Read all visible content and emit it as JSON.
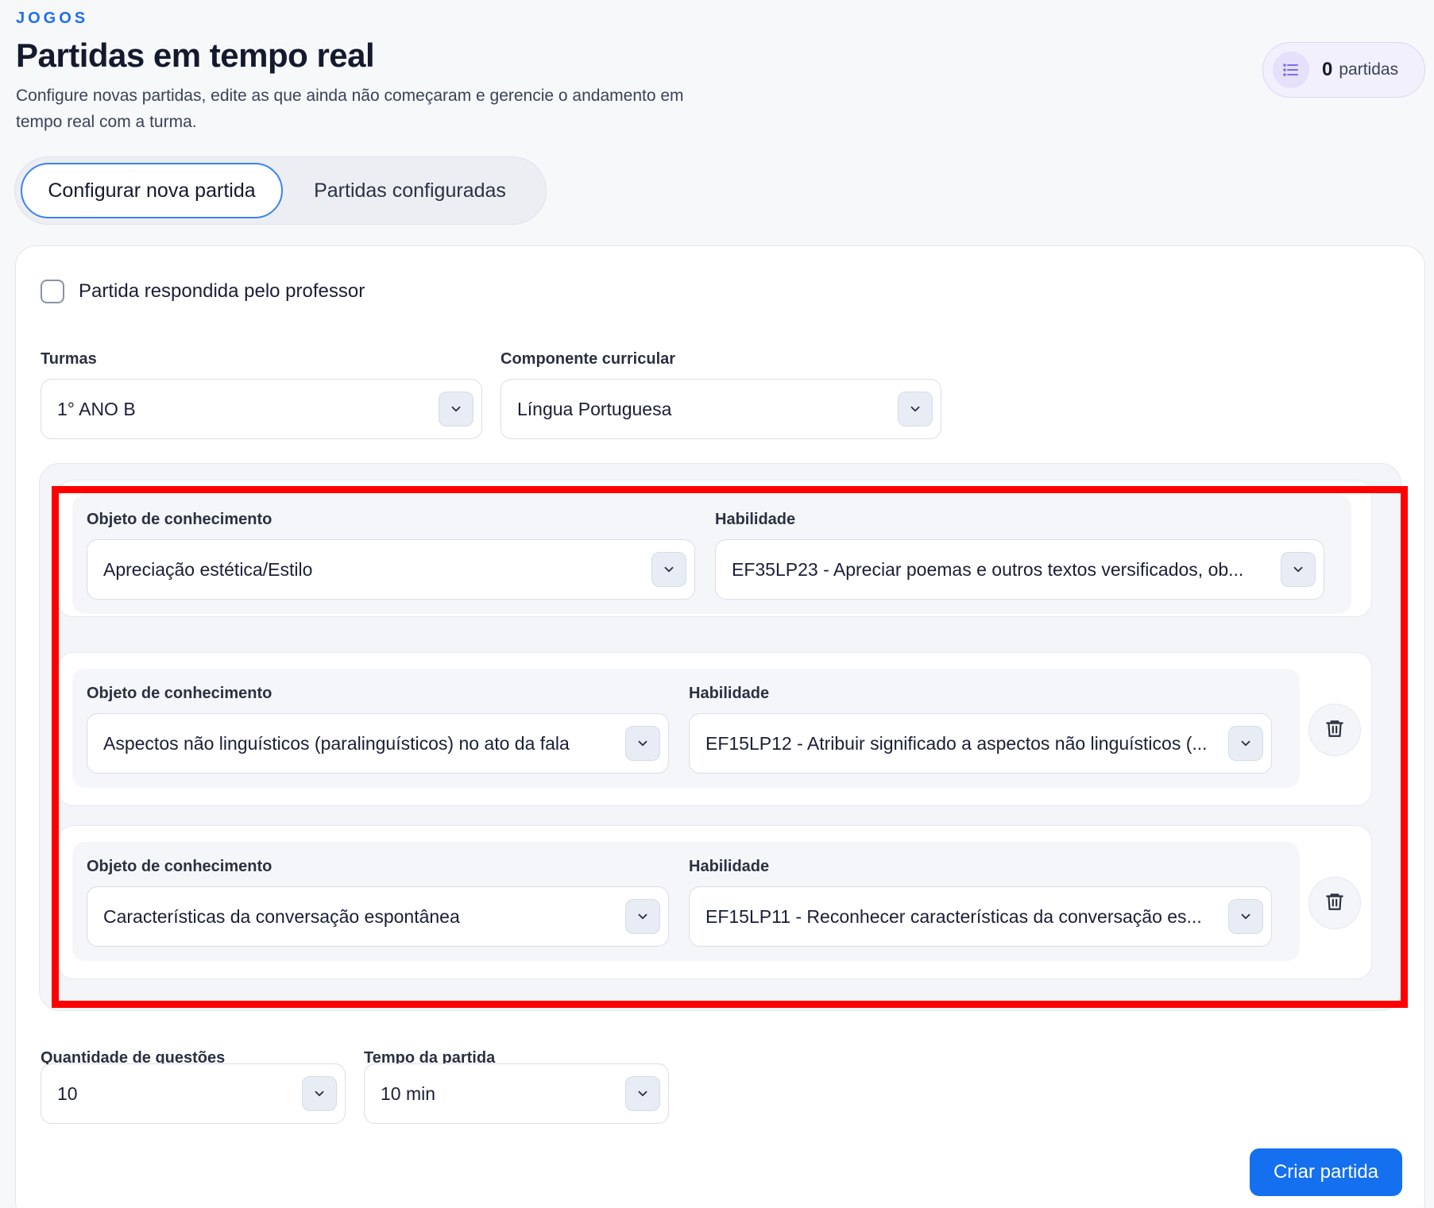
{
  "header": {
    "eyebrow": "JOGOS",
    "title": "Partidas em tempo real",
    "subtitle": "Configure novas partidas, edite as que ainda não começaram e gerencie o andamento em tempo real com a turma.",
    "count_value": "0",
    "count_label": "partidas",
    "count_icon": "list-icon"
  },
  "tabs": [
    {
      "label": "Configurar nova partida",
      "active": true
    },
    {
      "label": "Partidas configuradas",
      "active": false
    }
  ],
  "form": {
    "teacher_checkbox": {
      "label": "Partida respondida pelo professor",
      "checked": false
    },
    "turmas": {
      "label": "Turmas",
      "value": "1° ANO B"
    },
    "componente": {
      "label": "Componente curricular",
      "value": "Língua Portuguesa"
    },
    "objetos": [
      {
        "objeto_label": "Objeto de conhecimento",
        "objeto_value": "Apreciação estética/Estilo",
        "habilidade_label": "Habilidade",
        "habilidade_value": "EF35LP23 - Apreciar poemas e outros textos versificados, ob..."
      },
      {
        "objeto_label": "Objeto de conhecimento",
        "objeto_value": "Aspectos não linguísticos (paralinguísticos) no ato da fala",
        "habilidade_label": "Habilidade",
        "habilidade_value": "EF15LP12 - Atribuir significado a aspectos não linguísticos (..."
      },
      {
        "objeto_label": "Objeto de conhecimento",
        "objeto_value": "Características da conversação espontânea",
        "habilidade_label": "Habilidade",
        "habilidade_value": "EF15LP11 - Reconhecer características da conversação es..."
      }
    ],
    "quantidade": {
      "label": "Quantidade de questões",
      "value": "10"
    },
    "tempo": {
      "label": "Tempo da partida",
      "value": "10 min"
    },
    "submit_label": "Criar partida"
  },
  "colors": {
    "accent": "#1570ef",
    "highlight": "#ff0000"
  }
}
